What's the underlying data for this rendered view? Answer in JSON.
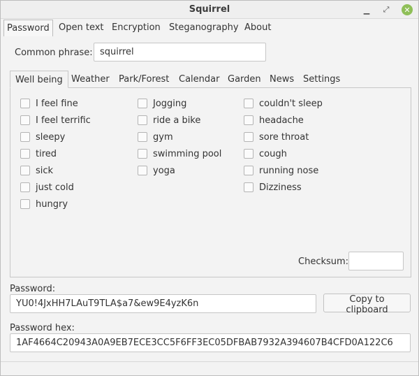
{
  "window": {
    "title": "Squirrel"
  },
  "main_tabs": [
    {
      "label": "Password",
      "active": true
    },
    {
      "label": "Open text"
    },
    {
      "label": "Encryption"
    },
    {
      "label": "Steganography"
    },
    {
      "label": "About"
    }
  ],
  "common_phrase": {
    "label": "Common phrase:",
    "value": "squirrel"
  },
  "inner_tabs": [
    {
      "label": "Well being",
      "active": true
    },
    {
      "label": "Weather"
    },
    {
      "label": "Park/Forest"
    },
    {
      "label": "Calendar"
    },
    {
      "label": "Garden"
    },
    {
      "label": "News"
    },
    {
      "label": "Settings"
    }
  ],
  "checkboxes": {
    "col1": [
      "I feel fine",
      "I feel terrific",
      "sleepy",
      "tired",
      "sick",
      "just cold",
      "hungry"
    ],
    "col2": [
      "Jogging",
      "ride a bike",
      "gym",
      "swimming pool",
      "yoga"
    ],
    "col3": [
      "couldn't sleep",
      "headache",
      "sore throat",
      "cough",
      "running nose",
      "Dizziness"
    ]
  },
  "checksum": {
    "label": "Checksum:",
    "value": ""
  },
  "password": {
    "label": "Password:",
    "value": "YU0!4JxHH7LAuT9TLA$a7&ew9E4yzK6n"
  },
  "copy_button": {
    "label": "Copy to clipboard"
  },
  "password_hex": {
    "label": "Password hex:",
    "value": "1AF4664C20943A0A9EB7ECE3CC5F6FF3EC05DFBAB7932A394607B4CFD0A122C6"
  }
}
